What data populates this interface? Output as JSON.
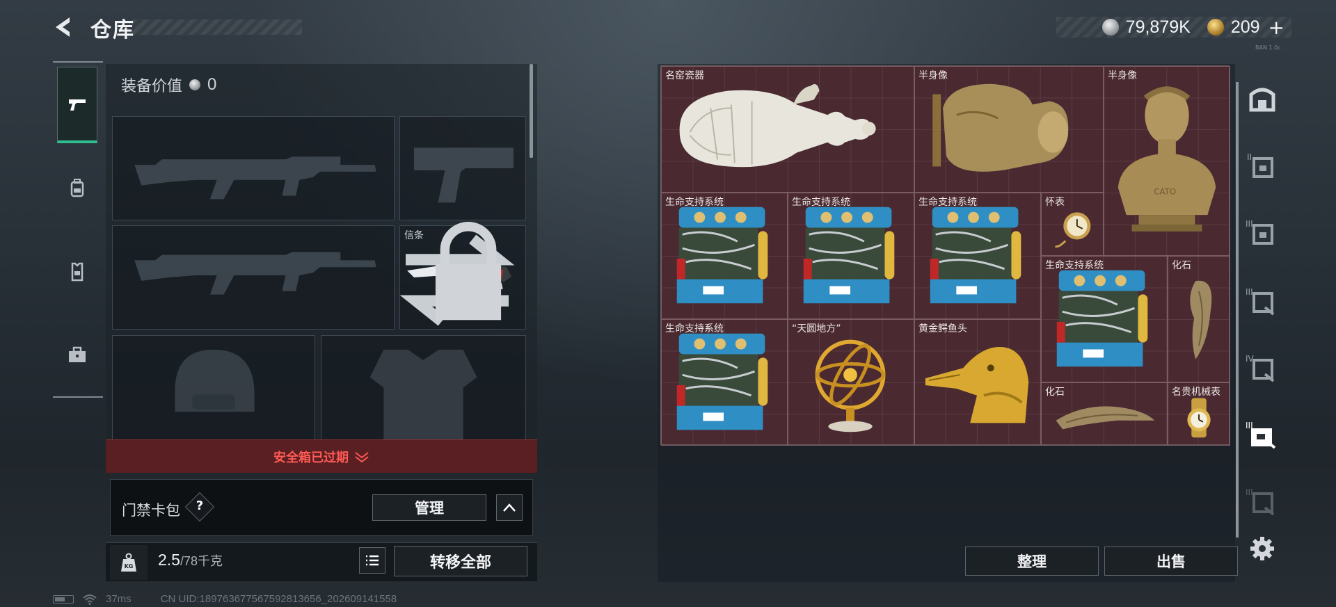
{
  "header": {
    "title": "仓库",
    "currency": [
      {
        "icon": "silver-coin-icon",
        "value": "79,879K"
      },
      {
        "icon": "gold-coin-icon",
        "value": "209"
      }
    ],
    "version": "BAN 1.0c"
  },
  "left_nav": [
    {
      "icon": "pistol-icon",
      "active": true
    },
    {
      "icon": "backpack-icon",
      "active": false
    },
    {
      "icon": "vest-icon",
      "active": false
    },
    {
      "icon": "toolbox-icon",
      "active": false
    }
  ],
  "loadout": {
    "equip_value_label": "装备价值",
    "equip_value": "0",
    "melee_label": "信条",
    "expired_text": "安全箱已过期",
    "keycard_label": "门禁卡包",
    "help_symbol": "?",
    "manage_label": "管理",
    "weight_current": "2.5",
    "weight_max": "/78千克",
    "weight_icon_text": "KG",
    "transfer_all_label": "转移全部"
  },
  "stash": {
    "items": [
      {
        "label": "名窑瓷器",
        "icon": "porcelain-vase-icon"
      },
      {
        "label": "半身像",
        "icon": "bust-icon"
      },
      {
        "label": "半身像",
        "icon": "bust-cato-icon"
      },
      {
        "label": "生命支持系统",
        "icon": "life-support-icon"
      },
      {
        "label": "生命支持系统",
        "icon": "life-support-icon"
      },
      {
        "label": "生命支持系统",
        "icon": "life-support-icon"
      },
      {
        "label": "怀表",
        "icon": "pocket-watch-icon"
      },
      {
        "label": "生命支持系统",
        "icon": "life-support-icon"
      },
      {
        "label": "化石",
        "icon": "fossil-claw-icon"
      },
      {
        "label": "生命支持系统",
        "icon": "life-support-icon"
      },
      {
        "label": "“天圆地方”",
        "icon": "armillary-sphere-icon"
      },
      {
        "label": "黄金鳄鱼头",
        "icon": "golden-crocodile-head-icon"
      },
      {
        "label": "化石",
        "icon": "fossil-horn-icon"
      },
      {
        "label": "名贵机械表",
        "icon": "luxury-watch-icon"
      }
    ],
    "sort_label": "整理",
    "sell_label": "出售"
  },
  "right_nav": [
    {
      "icon": "stash-home-icon"
    },
    {
      "icon": "stash-tab-2-icon",
      "tier": "II"
    },
    {
      "icon": "stash-tab-3-icon",
      "tier": "III"
    },
    {
      "icon": "stash-tab-3b-icon",
      "tier": "III"
    },
    {
      "icon": "stash-tab-4-icon",
      "tier": "IV"
    },
    {
      "icon": "stash-tab-active-icon",
      "tier": "III"
    },
    {
      "icon": "stash-tab-locked-icon",
      "tier": "III"
    }
  ],
  "status_bar": {
    "ping": "37ms",
    "uid": "CN UID:1897636775675928136​56_202609141558"
  },
  "colors": {
    "stash_bg": "#4a2a30",
    "expired_red": "#ff5a55",
    "active_green": "#2fbf8f"
  }
}
